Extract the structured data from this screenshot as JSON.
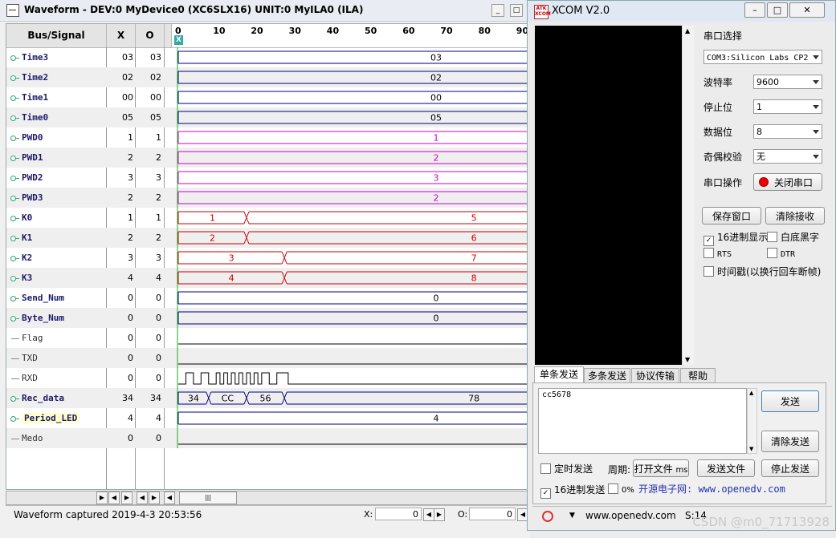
{
  "waveform_window": {
    "title": "Waveform - DEV:0 MyDevice0 (XC6SLX16) UNIT:0 MyILA0 (ILA)",
    "headers": {
      "bus_signal": "Bus/Signal",
      "x": "X",
      "o": "O"
    },
    "ruler_ticks": [
      "0",
      "10",
      "20",
      "30",
      "40",
      "50",
      "60",
      "70",
      "80",
      "90"
    ],
    "cursor_label": "X",
    "signals": [
      {
        "name": "Time3",
        "x": "03",
        "o": "03",
        "kind": "bus",
        "color": "#000080",
        "segments": [
          {
            "label": "03",
            "from": 0,
            "to": 95
          }
        ]
      },
      {
        "name": "Time2",
        "x": "02",
        "o": "02",
        "kind": "bus",
        "color": "#000080",
        "segments": [
          {
            "label": "02",
            "from": 0,
            "to": 95
          }
        ]
      },
      {
        "name": "Time1",
        "x": "00",
        "o": "00",
        "kind": "bus",
        "color": "#000080",
        "segments": [
          {
            "label": "00",
            "from": 0,
            "to": 95
          }
        ]
      },
      {
        "name": "Time0",
        "x": "05",
        "o": "05",
        "kind": "bus",
        "color": "#000080",
        "segments": [
          {
            "label": "05",
            "from": 0,
            "to": 95
          }
        ]
      },
      {
        "name": "PWD0",
        "x": "1",
        "o": "1",
        "kind": "bus",
        "color": "#cc00cc",
        "segments": [
          {
            "label": "1",
            "from": 0,
            "to": 95
          }
        ]
      },
      {
        "name": "PWD1",
        "x": "2",
        "o": "2",
        "kind": "bus",
        "color": "#cc00cc",
        "segments": [
          {
            "label": "2",
            "from": 0,
            "to": 95
          }
        ]
      },
      {
        "name": "PWD2",
        "x": "3",
        "o": "3",
        "kind": "bus",
        "color": "#cc00cc",
        "segments": [
          {
            "label": "3",
            "from": 0,
            "to": 95
          }
        ]
      },
      {
        "name": "PWD3",
        "x": "2",
        "o": "2",
        "kind": "bus",
        "color": "#cc00cc",
        "segments": [
          {
            "label": "2",
            "from": 0,
            "to": 95
          }
        ]
      },
      {
        "name": "K0",
        "x": "1",
        "o": "1",
        "kind": "bus",
        "color": "#cc0000",
        "segments": [
          {
            "label": "1",
            "from": 0,
            "to": 18
          },
          {
            "label": "5",
            "from": 18,
            "to": 95
          }
        ]
      },
      {
        "name": "K1",
        "x": "2",
        "o": "2",
        "kind": "bus",
        "color": "#cc0000",
        "segments": [
          {
            "label": "2",
            "from": 0,
            "to": 18
          },
          {
            "label": "6",
            "from": 18,
            "to": 95
          }
        ]
      },
      {
        "name": "K2",
        "x": "3",
        "o": "3",
        "kind": "bus",
        "color": "#cc0000",
        "segments": [
          {
            "label": "3",
            "from": 0,
            "to": 28
          },
          {
            "label": "7",
            "from": 28,
            "to": 95
          }
        ]
      },
      {
        "name": "K3",
        "x": "4",
        "o": "4",
        "kind": "bus",
        "color": "#cc0000",
        "segments": [
          {
            "label": "4",
            "from": 0,
            "to": 28
          },
          {
            "label": "8",
            "from": 28,
            "to": 95
          }
        ]
      },
      {
        "name": "Send_Num",
        "x": "0",
        "o": "0",
        "kind": "bus",
        "color": "#000080",
        "segments": [
          {
            "label": "0",
            "from": 0,
            "to": 95
          }
        ]
      },
      {
        "name": "Byte_Num",
        "x": "0",
        "o": "0",
        "kind": "bus",
        "color": "#000080",
        "segments": [
          {
            "label": "0",
            "from": 0,
            "to": 95
          }
        ]
      },
      {
        "name": "Flag",
        "x": "0",
        "o": "0",
        "kind": "bit",
        "color": "#000000",
        "edges": []
      },
      {
        "name": "TXD",
        "x": "0",
        "o": "0",
        "kind": "bit",
        "color": "#000000",
        "edges": []
      },
      {
        "name": "RXD",
        "x": "0",
        "o": "0",
        "kind": "bit",
        "color": "#000000",
        "edges": [
          2,
          4,
          6,
          8,
          10,
          11,
          12,
          13,
          14,
          15,
          16,
          17,
          18,
          19,
          20,
          21,
          22,
          24,
          26,
          29
        ]
      },
      {
        "name": "Rec_data",
        "x": "34",
        "o": "34",
        "kind": "bus",
        "color": "#000080",
        "segments": [
          {
            "label": "34",
            "from": 0,
            "to": 8
          },
          {
            "label": "CC",
            "from": 8,
            "to": 18
          },
          {
            "label": "56",
            "from": 18,
            "to": 28
          },
          {
            "label": "78",
            "from": 28,
            "to": 95
          }
        ]
      },
      {
        "name": "Period_LED",
        "x": "4",
        "o": "4",
        "kind": "bus",
        "color": "#000080",
        "highlight": true,
        "segments": [
          {
            "label": "4",
            "from": 0,
            "to": 95
          }
        ]
      },
      {
        "name": "Medo",
        "x": "0",
        "o": "0",
        "kind": "bit",
        "color": "#000000",
        "edges": []
      }
    ],
    "status": "Waveform captured 2019-4-3 20:53:56",
    "x_label": "X:",
    "x_value": "0",
    "o_label": "O:",
    "o_value": "0"
  },
  "xcom": {
    "title": "XCOM V2.0",
    "logo_text": "ATK XCOM",
    "labels": {
      "port_select": "串口选择",
      "baud": "波特率",
      "stop_bits": "停止位",
      "data_bits": "数据位",
      "parity": "奇偶校验",
      "port_op": "串口操作"
    },
    "values": {
      "port": "COM3:Silicon Labs CP2",
      "baud": "9600",
      "stop_bits": "1",
      "data_bits": "8",
      "parity": "无"
    },
    "buttons": {
      "close_port": "关闭串口",
      "save_window": "保存窗口",
      "clear_receive": "清除接收",
      "send": "发送",
      "clear_send": "清除发送",
      "open_file": "打开文件",
      "send_file": "发送文件",
      "stop_send": "停止发送"
    },
    "checkboxes": {
      "hex_display": {
        "label": "16进制显示",
        "checked": true
      },
      "white_bg": {
        "label": "白底黑字",
        "checked": false
      },
      "rts": {
        "label": "RTS",
        "checked": false
      },
      "dtr": {
        "label": "DTR",
        "checked": false
      },
      "timestamp": {
        "label": "时间戳(以换行回车断帧)",
        "checked": false
      },
      "timed_send": {
        "label": "定时发送",
        "checked": false
      },
      "hex_send": {
        "label": "16进制发送",
        "checked": true
      },
      "newline": {
        "label": "0%",
        "checked": false
      }
    },
    "tabs": [
      "单条发送",
      "多条发送",
      "协议传输",
      "帮助"
    ],
    "send_text": "cc5678",
    "period_label": "周期:",
    "period_unit": "ms",
    "link_text": "开源电子网: www.openedv.com",
    "statusbar": {
      "site": "www.openedv.com",
      "s_count": "S:14"
    }
  },
  "watermark": "CSDN @m0_71713928"
}
